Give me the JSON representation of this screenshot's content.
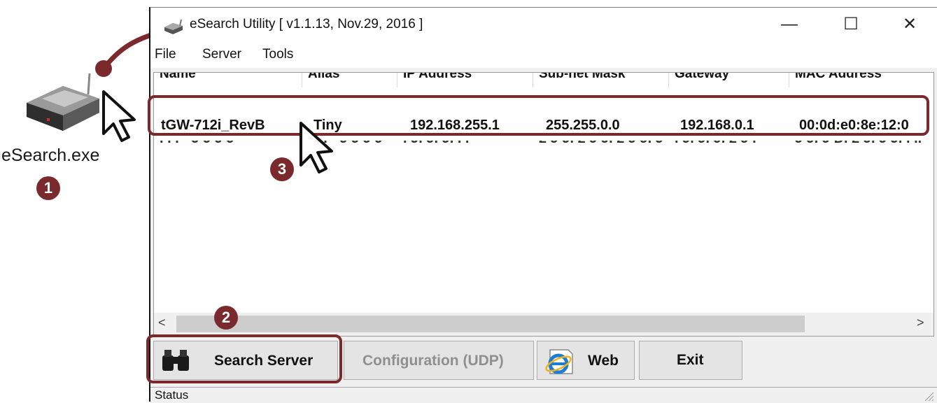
{
  "desktop": {
    "icon_name": "router-icon",
    "label": "eSearch.exe"
  },
  "steps": {
    "one": "❶",
    "two": "2",
    "three": "3"
  },
  "window": {
    "title": "eSearch Utility [ v1.1.13, Nov.29, 2016 ]",
    "controls": {
      "minimize": "—",
      "maximize": "☐",
      "close": "✕"
    }
  },
  "menu": [
    "File",
    "Server",
    "Tools"
  ],
  "table": {
    "columns": [
      "Name",
      "Alias",
      "IP Address",
      "Sub-net Mask",
      "Gateway",
      "MAC Address"
    ],
    "rows": [
      {
        "name": "tGW-712i_RevB",
        "alias": "Tiny",
        "ip": "192.168.255.1",
        "mask": "255.255.0.0",
        "gateway": "192.168.0.1",
        "mac": "00:0d:e0:8e:12:0"
      }
    ]
  },
  "scroll": {
    "left": "<",
    "right": ">"
  },
  "buttons": {
    "search": "Search Server",
    "config": "Configuration (UDP)",
    "web": "Web",
    "exit": "Exit"
  },
  "status": "Status",
  "colors": {
    "accent": "#7a2a2c"
  }
}
